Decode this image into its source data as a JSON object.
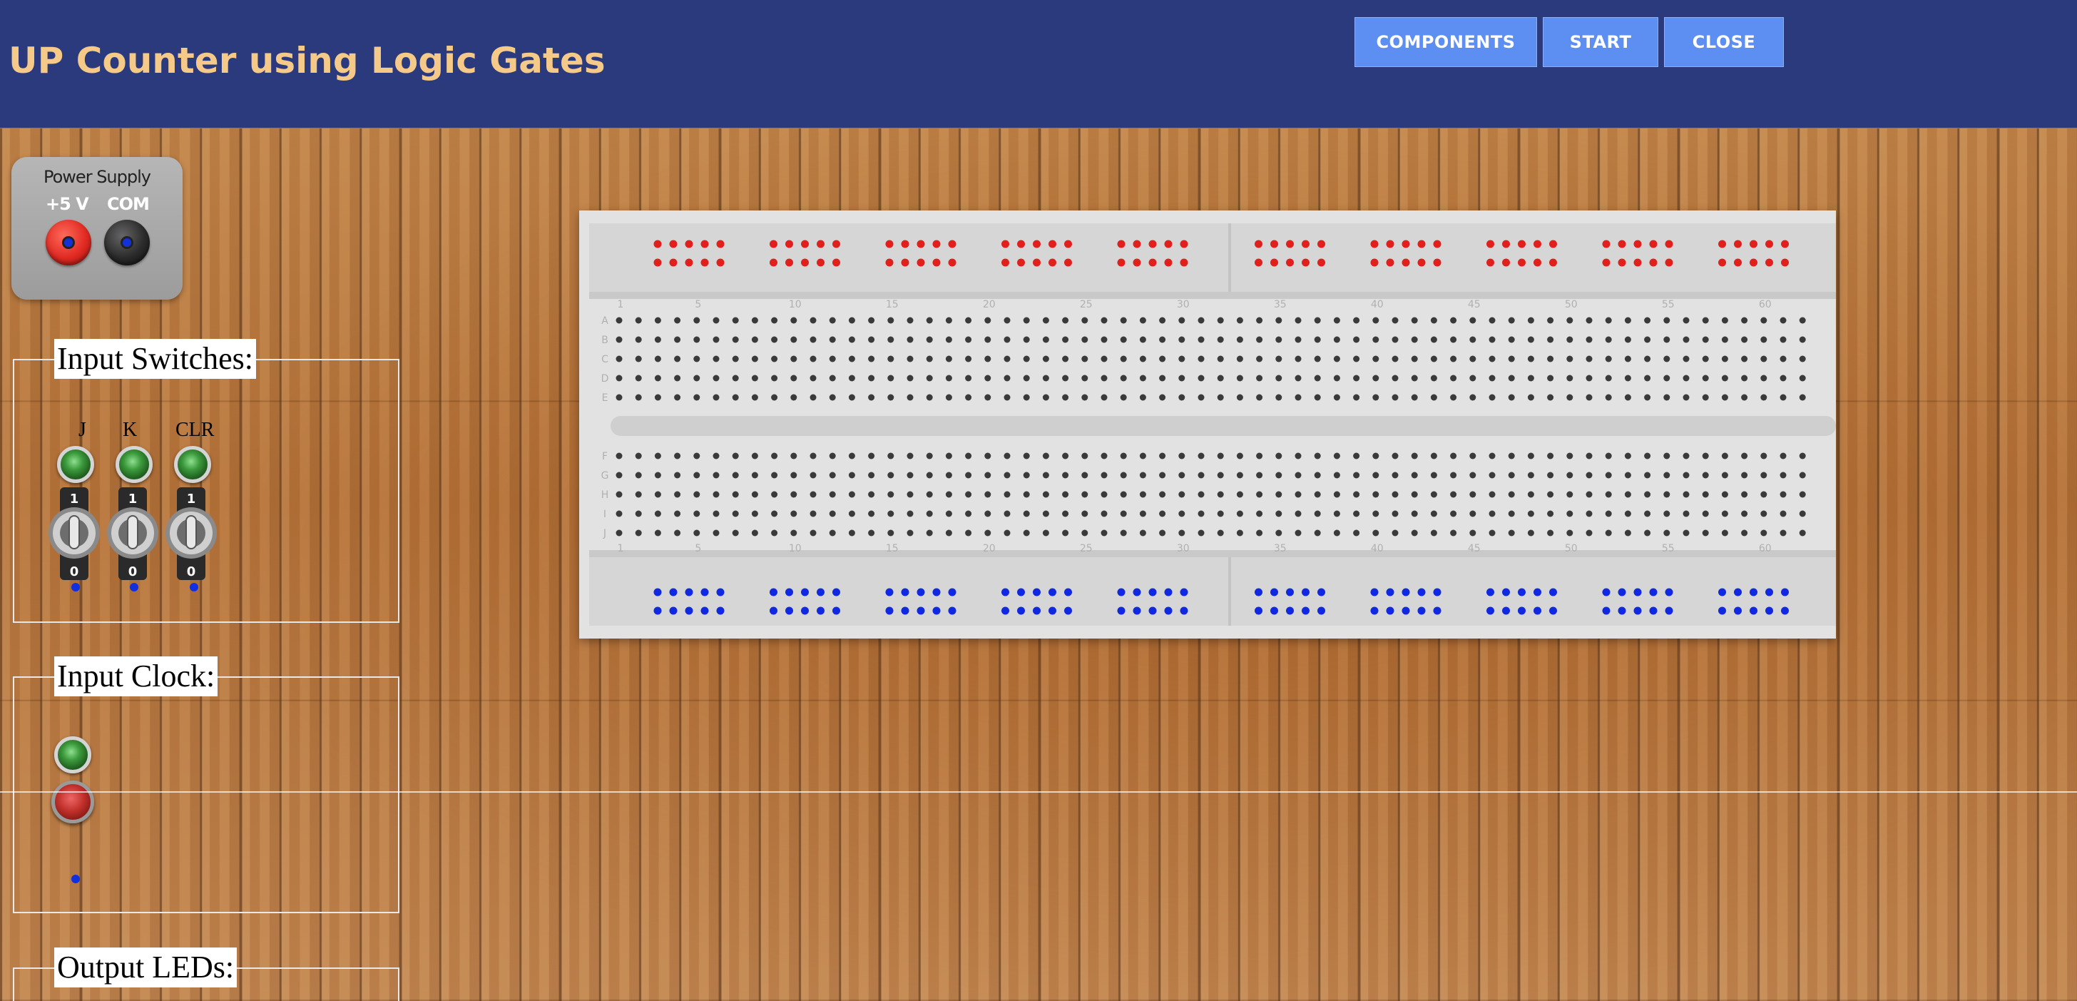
{
  "header": {
    "title": "UP Counter using Logic Gates",
    "buttons": {
      "components": "COMPONENTS",
      "start": "START",
      "close": "CLOSE"
    }
  },
  "power_supply": {
    "title": "Power Supply",
    "plus_label": "+5 V",
    "com_label": "COM"
  },
  "input_switches": {
    "legend": "Input Switches:",
    "switches": [
      {
        "label": "J"
      },
      {
        "label": "K"
      },
      {
        "label": "CLR"
      }
    ],
    "toggle_on": "1",
    "toggle_off": "0"
  },
  "input_clock": {
    "legend": "Input Clock:"
  },
  "output_leds": {
    "legend": "Output LEDs:"
  },
  "breadboard": {
    "row_letters_top": [
      "A",
      "B",
      "C",
      "D",
      "E"
    ],
    "row_letters_bottom": [
      "F",
      "G",
      "H",
      "I",
      "J"
    ],
    "column_numbers": [
      "1",
      "5",
      "10",
      "15",
      "20",
      "25",
      "30",
      "35",
      "40",
      "45",
      "50",
      "55",
      "60"
    ]
  },
  "colors": {
    "header_bg": "#2b3a7c",
    "title": "#f5c987",
    "button_bg": "#5d8ef2",
    "rail_positive": "#e0201c",
    "rail_negative": "#1028e0",
    "terminal_positive": "#e02a22",
    "terminal_com": "#2a2a2a"
  }
}
